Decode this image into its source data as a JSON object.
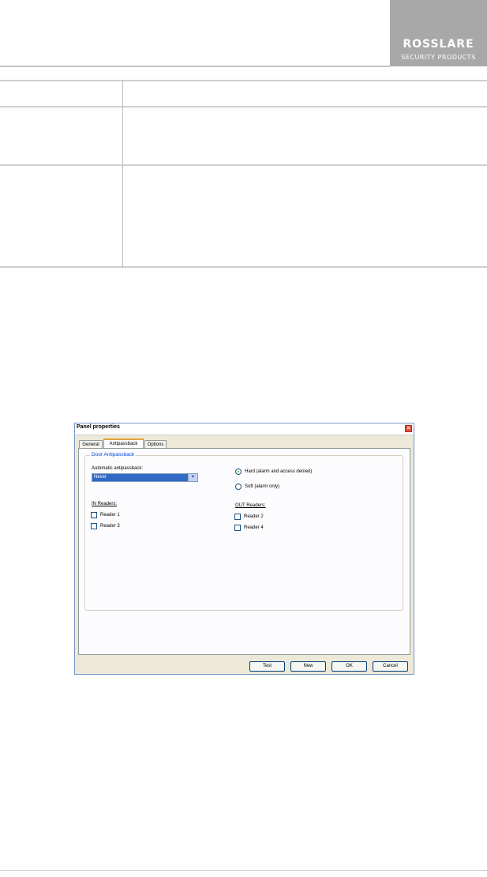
{
  "header": {
    "logo_main": "ROSSLARE",
    "logo_sub": "SECURITY PRODUCTS"
  },
  "dialog": {
    "title": "Panel properties",
    "tabs": [
      {
        "label": "General"
      },
      {
        "label": "Antipassback"
      },
      {
        "label": "Options"
      }
    ],
    "group_label": "Door Antipassback",
    "auto_label": "Automatic antipassback:",
    "auto_value": "Never",
    "radio_hard": "Hard (alarm and access denied)",
    "radio_soft": "Soft (alarm only)",
    "in_readers_label": "IN Readers:",
    "out_readers_label": "OUT Readers:",
    "readers": {
      "r1": "Reader 1",
      "r3": "Reader 3",
      "r2": "Reader 2",
      "r4": "Reader 4"
    },
    "buttons": {
      "test": "Test",
      "new": "New",
      "ok": "OK",
      "cancel": "Cancel"
    }
  }
}
